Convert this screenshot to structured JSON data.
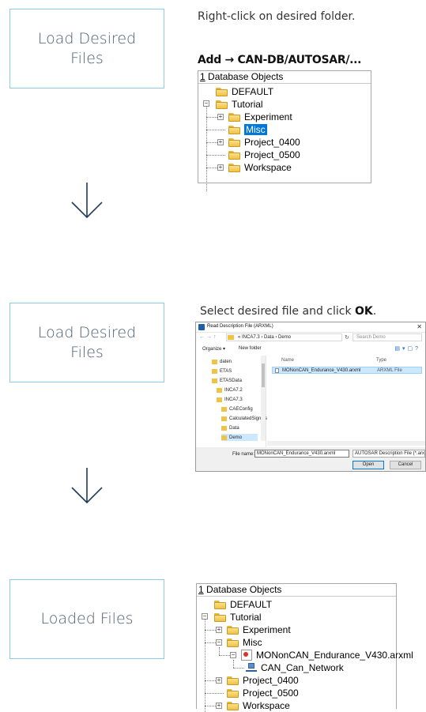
{
  "steps": [
    {
      "label": "Load Desired Files"
    },
    {
      "label": "Load Desired Files"
    },
    {
      "label": "Loaded Files"
    }
  ],
  "step1": {
    "instruction": "Right-click on desired folder.",
    "add_line": "Add → CAN-DB/AUTOSAR/...",
    "tree": {
      "header_num": "1",
      "header_rest": " Database Objects",
      "items": [
        "DEFAULT",
        "Tutorial",
        "Experiment",
        "Misc",
        "Project_0400",
        "Project_0500",
        "Workspace"
      ]
    }
  },
  "step2": {
    "instruction_pre": "Select desired file and click ",
    "instruction_bold": "OK",
    "instruction_post": ".",
    "dialog": {
      "title": "Read Description File (ARXML)",
      "breadcrumb": "« INCA7.3 › Data › Demo",
      "search_placeholder": "Search Demo",
      "organize": "Organize ▾",
      "new_folder": "New folder",
      "nav_items": [
        "daten",
        "ETAS",
        "ETASData",
        "INCA7.2",
        "INCA7.3",
        "CAEConfig",
        "CalculatedSignals",
        "Data",
        "Demo"
      ],
      "col_name": "Name",
      "col_type": "Type",
      "file_name": "MONonCAN_Endurance_V430.arxml",
      "file_type": "ARXML File",
      "filename_label": "File name:",
      "filename_value": "MONonCAN_Endurance_V430.arxml",
      "filetype_value": "AUTOSAR Description File (*.arx",
      "open_label": "Open",
      "cancel_label": "Cancel"
    }
  },
  "step3": {
    "tree": {
      "header_num": "1",
      "header_rest": " Database Objects",
      "items": [
        "DEFAULT",
        "Tutorial",
        "Experiment",
        "Misc",
        "MONonCAN_Endurance_V430.arxml",
        "CAN_Can_Network",
        "Project_0400",
        "Project_0500",
        "Workspace"
      ]
    }
  }
}
